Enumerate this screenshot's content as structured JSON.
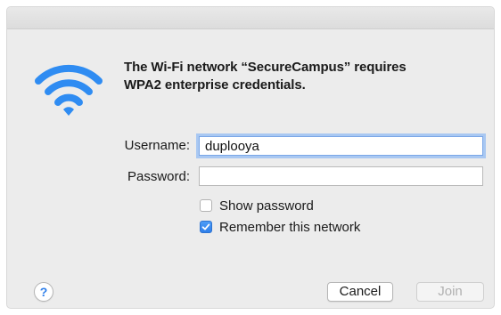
{
  "dialog": {
    "message": "The Wi-Fi network “SecureCampus” requires WPA2 enterprise credentials.",
    "message_line1": "The Wi-Fi network “SecureCampus” requires",
    "message_line2": "WPA2 enterprise credentials.",
    "icon": "wifi-icon",
    "accent_color": "#2f8cf2"
  },
  "form": {
    "username_label": "Username:",
    "username_value": "duplooya",
    "password_label": "Password:",
    "password_value": "",
    "show_password_label": "Show password",
    "show_password_checked": false,
    "remember_network_label": "Remember this network",
    "remember_network_checked": true
  },
  "buttons": {
    "help_label": "?",
    "cancel_label": "Cancel",
    "join_label": "Join",
    "join_enabled": false
  }
}
